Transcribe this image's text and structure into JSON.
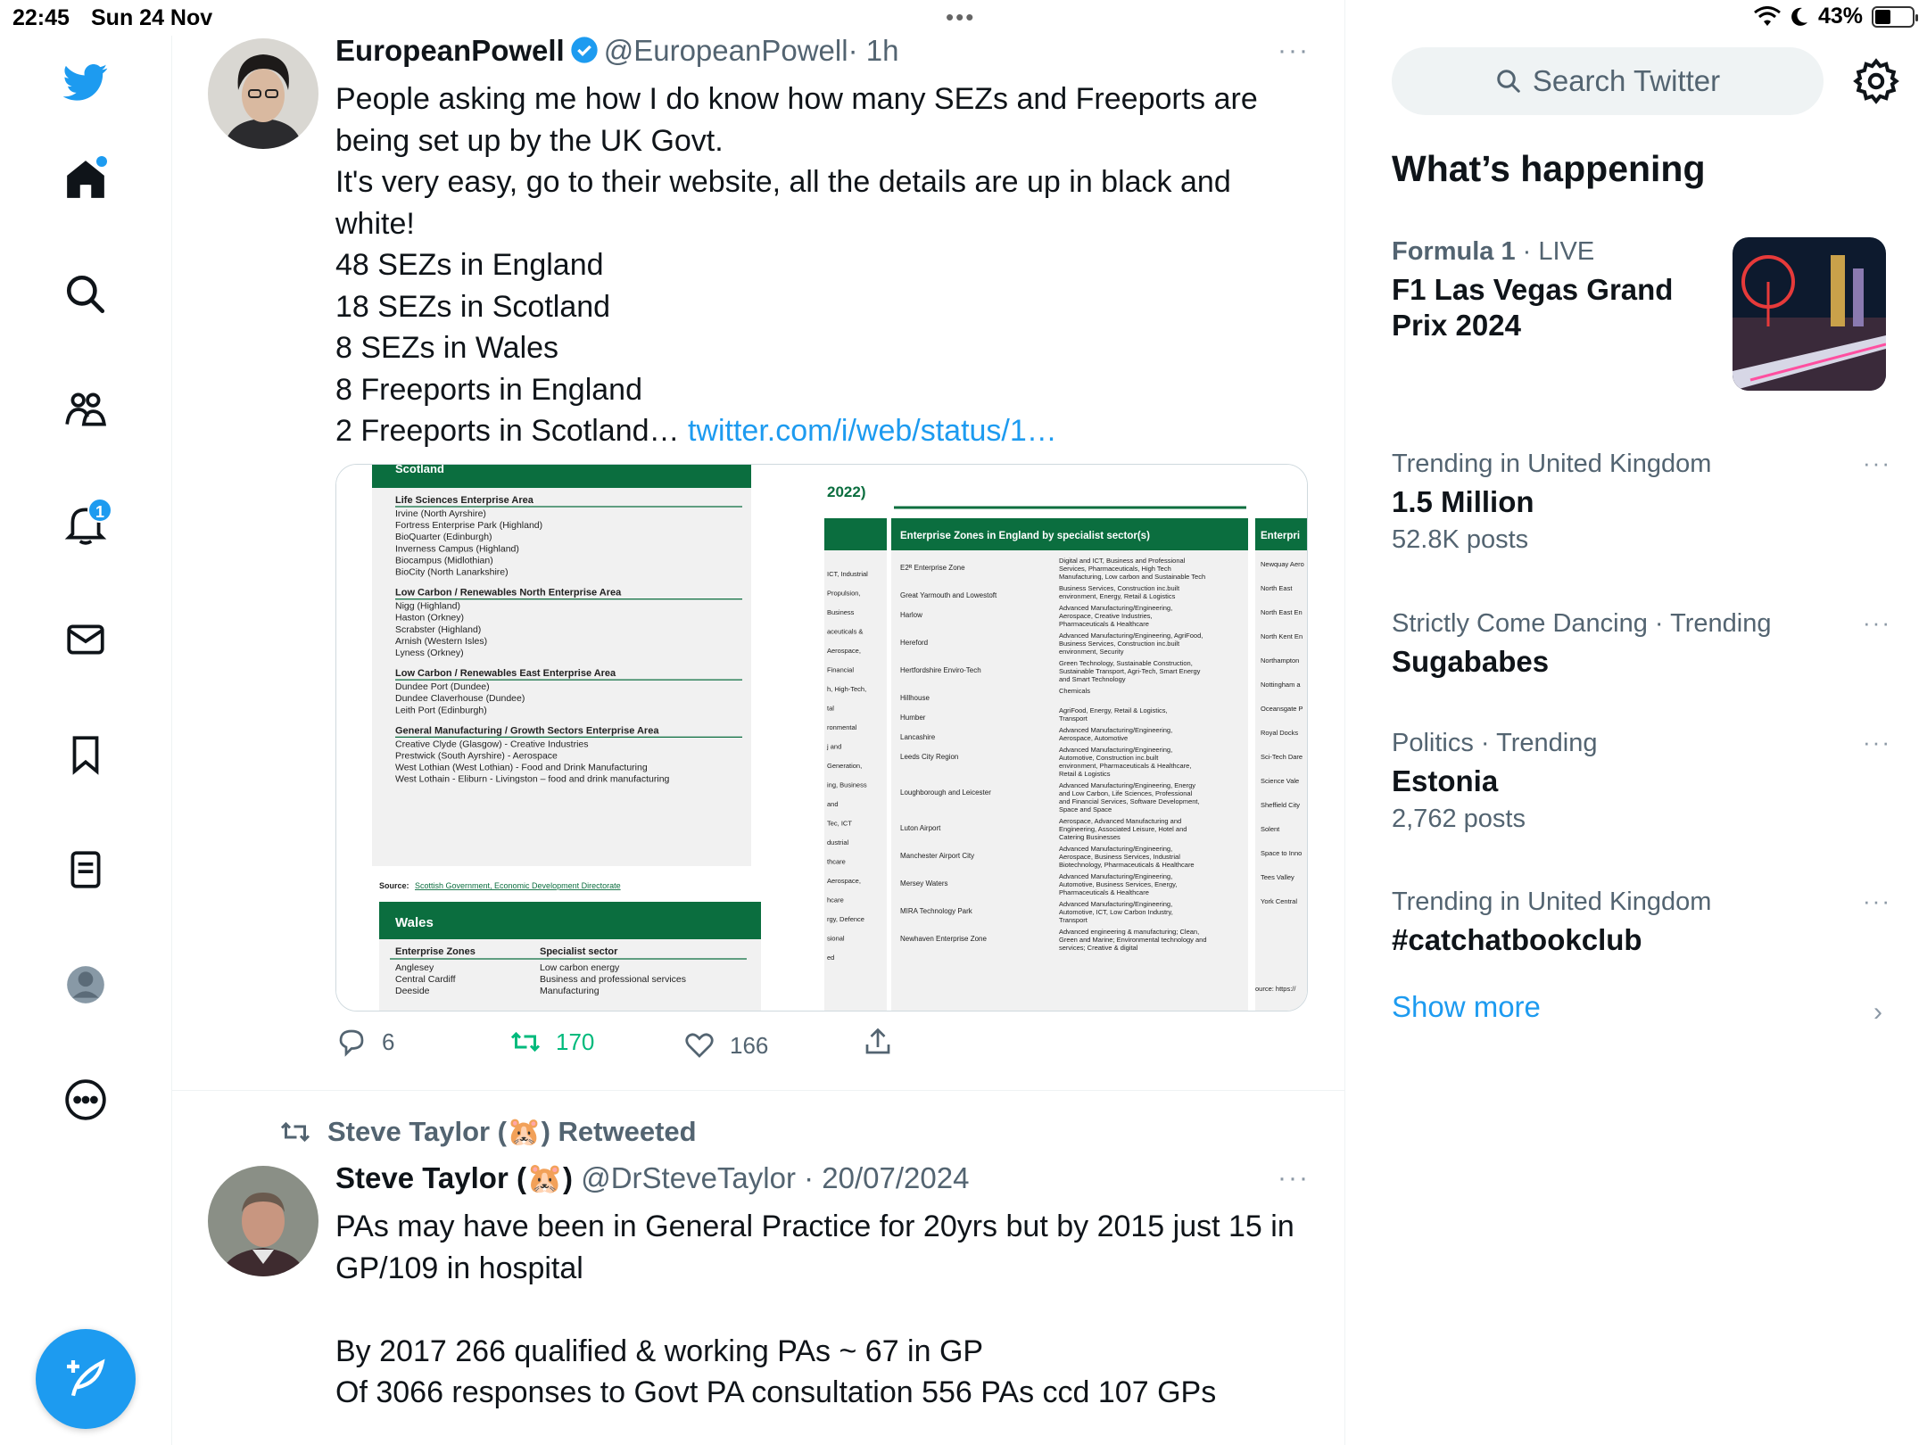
{
  "status_bar": {
    "time": "22:45",
    "date": "Sun 24 Nov",
    "battery": "43%",
    "battery_level": 0.43,
    "dots": "•••"
  },
  "nav": {
    "notifications_badge": "1",
    "items": [
      "Twitter",
      "Home",
      "Explore",
      "Communities",
      "Notifications",
      "Messages",
      "Bookmarks",
      "Lists",
      "Profile",
      "More"
    ]
  },
  "tweets": [
    {
      "name": "EuropeanPowell",
      "handle": "@EuropeanPowell",
      "time": "· 1h",
      "more": "···",
      "text": "People asking me how I do know how many SEZs and Freeports are being set up by the UK Govt.\nIt's very easy, go to their website, all the details are up in black and white!\n48 SEZs in England\n18 SEZs in Scotland\n8 SEZs in Wales\n8 Freeports in England\n2 Freeports in Scotland… ",
      "link": "twitter.com/i/web/status/1…",
      "replies": "6",
      "retweets": "170",
      "likes": "166"
    },
    {
      "retweeted_by": "Steve Taylor (🐹) Retweeted",
      "name": "Steve Taylor (🐹)",
      "handle": "@DrSteveTaylor",
      "time": "· 20/07/2024",
      "more": "···",
      "text": "PAs may have been in General Practice for 20yrs but by 2015 just 15 in GP/109 in hospital\n\nBy 2017 266 qualified & working PAs ~ 67 in GP\nOf 3066 responses to Govt PA consultation 556 PAs ccd 107 GPs"
    }
  ],
  "media": {
    "scotland_header": "Scotland",
    "scotland_sections": [
      {
        "title": "Life Sciences Enterprise Area",
        "items": [
          "Irvine (North Ayrshire)",
          "Fortress Enterprise Park (Highland)",
          "BioQuarter (Edinburgh)",
          "Inverness Campus (Highland)",
          "Biocampus (Midlothian)",
          "BioCity (North Lanarkshire)"
        ]
      },
      {
        "title": "Low Carbon / Renewables North Enterprise Area",
        "items": [
          "Nigg (Highland)",
          "Haston (Orkney)",
          "Scrabster (Highland)",
          "Arnish (Western Isles)",
          "Lyness (Orkney)"
        ]
      },
      {
        "title": "Low Carbon / Renewables East Enterprise Area",
        "items": [
          "Dundee Port (Dundee)",
          "Dundee Claverhouse (Dundee)",
          "Leith Port (Edinburgh)"
        ]
      },
      {
        "title": "General Manufacturing / Growth Sectors Enterprise Area",
        "items": [
          "Creative Clyde (Glasgow) - Creative Industries",
          "Prestwick (South Ayrshire) - Aerospace",
          "West Lothian (West Lothian) - Food and Drink Manufacturing",
          "West Lothain - Eliburn - Livingston – food and drink manufacturing"
        ]
      }
    ],
    "source_label": "Source:",
    "source_text": "Scottish Government, Economic Development Directorate",
    "wales_header": "Wales",
    "wales_col1": "Enterprise Zones",
    "wales_col2": "Specialist sector",
    "wales_rows": [
      [
        "Anglesey",
        "Low carbon energy"
      ],
      [
        "Central Cardiff",
        "Business and professional services"
      ],
      [
        "Deeside",
        "Manufacturing"
      ]
    ],
    "year_fragment": "2022)",
    "england_header": "Enterprise Zones in England by specialist sector(s)",
    "england_rows": [
      [
        "E2ᴿ Enterprise Zone",
        "Digital and ICT, Business and Professional Services, Pharmaceuticals, High Tech Manufacturing, Low carbon and Sustainable Tech"
      ],
      [
        "Great Yarmouth and Lowestoft",
        "Business Services, Construction inc.built environment, Energy, Retail & Logistics"
      ],
      [
        "Harlow",
        "Advanced Manufacturing/Engineering, Aerospace, Creative Industries, Pharmaceuticals & Healthcare"
      ],
      [
        "Hereford",
        "Advanced Manufacturing/Engineering, AgriFood, Business Services, Construction inc.built environment, Security"
      ],
      [
        "Hertfordshire Enviro-Tech",
        "Green Technology, Sustainable Construction, Sustainable Transport, Agri-Tech, Smart Energy and Smart Technology"
      ],
      [
        "Hillhouse",
        "Chemicals"
      ],
      [
        "Humber",
        "AgriFood, Energy, Retail & Logistics, Transport"
      ],
      [
        "Lancashire",
        "Advanced Manufacturing/Engineering, Aerospace, Automotive"
      ],
      [
        "Leeds City Region",
        "Advanced Manufacturing/Engineering, Automotive, Construction inc.built environment, Pharmaceuticals & Healthcare, Retail & Logistics"
      ],
      [
        "Loughborough and Leicester",
        "Advanced Manufacturing/Engineering, Energy and Low Carbon, Life Sciences, Professional and Financial Services, Software Development, Space and Space"
      ],
      [
        "Luton Airport",
        "Aerospace, Advanced Manufacturing and Engineering, Associated Leisure, Hotel and Catering Businesses"
      ],
      [
        "Manchester Airport City",
        "Advanced Manufacturing/Engineering, Aerospace, Business Services, Industrial Biotechnology, Pharmaceuticals & Healthcare"
      ],
      [
        "Mersey Waters",
        "Advanced Manufacturing/Engineering, Automotive, Business Services, Energy, Pharmaceuticals & Healthcare"
      ],
      [
        "MIRA Technology Park",
        "Advanced Manufacturing/Engineering, Automotive, ICT, Low Carbon Industry, Transport"
      ],
      [
        "Newhaven Enterprise Zone",
        "Advanced engineering & manufacturing; Clean, Green and Marine; Environmental technology and services; Creative & digital"
      ]
    ],
    "left_fragments": [
      "ICT, Industrial",
      "Propulsion,",
      "Business",
      "aceuticals &",
      "Aerospace,",
      "Financial",
      "h, High-Tech,",
      "tal",
      "ronmental",
      "j and",
      "Generation,",
      "ing, Business",
      "and",
      "Tec, ICT",
      "dustrial",
      "thcare",
      "Aerospace,",
      "hcare",
      "rgy, Defence",
      "sional",
      "ed"
    ],
    "right_header": "Enterpri",
    "right_fragments": [
      "Newquay Aero",
      "North East",
      "North East En",
      "North Kent En",
      "Northampton",
      "Nottingham a",
      "Oceansgate P",
      "Royal Docks",
      "Sci-Tech Dare",
      "Science Vale",
      "Sheffield City",
      "Solent",
      "Space to Inno",
      "Tees Valley",
      "York Central"
    ],
    "right_source": "ource: https://"
  },
  "sidebar": {
    "search_placeholder": "Search Twitter",
    "section_title": "What’s happening",
    "trends": [
      {
        "context": "Formula 1",
        "context_suffix": " · LIVE",
        "title": "F1 Las Vegas Grand Prix 2024"
      },
      {
        "context": "Trending in United Kingdom",
        "title": "1.5 Million",
        "count": "52.8K posts"
      },
      {
        "context": "Strictly Come Dancing · Trending",
        "title": "Sugababes"
      },
      {
        "context": "Politics · Trending",
        "title": "Estonia",
        "count": "2,762 posts"
      },
      {
        "context": "Trending in United Kingdom",
        "title": "#catchatbookclub"
      }
    ],
    "trend_more": "···",
    "show_more": "Show more",
    "show_more_chevron": "›"
  },
  "colors": {
    "accent": "#1d9bf0",
    "retweet_green": "#00ba7c",
    "doc_green": "#0b6e3f",
    "secondary_text": "#536471"
  }
}
